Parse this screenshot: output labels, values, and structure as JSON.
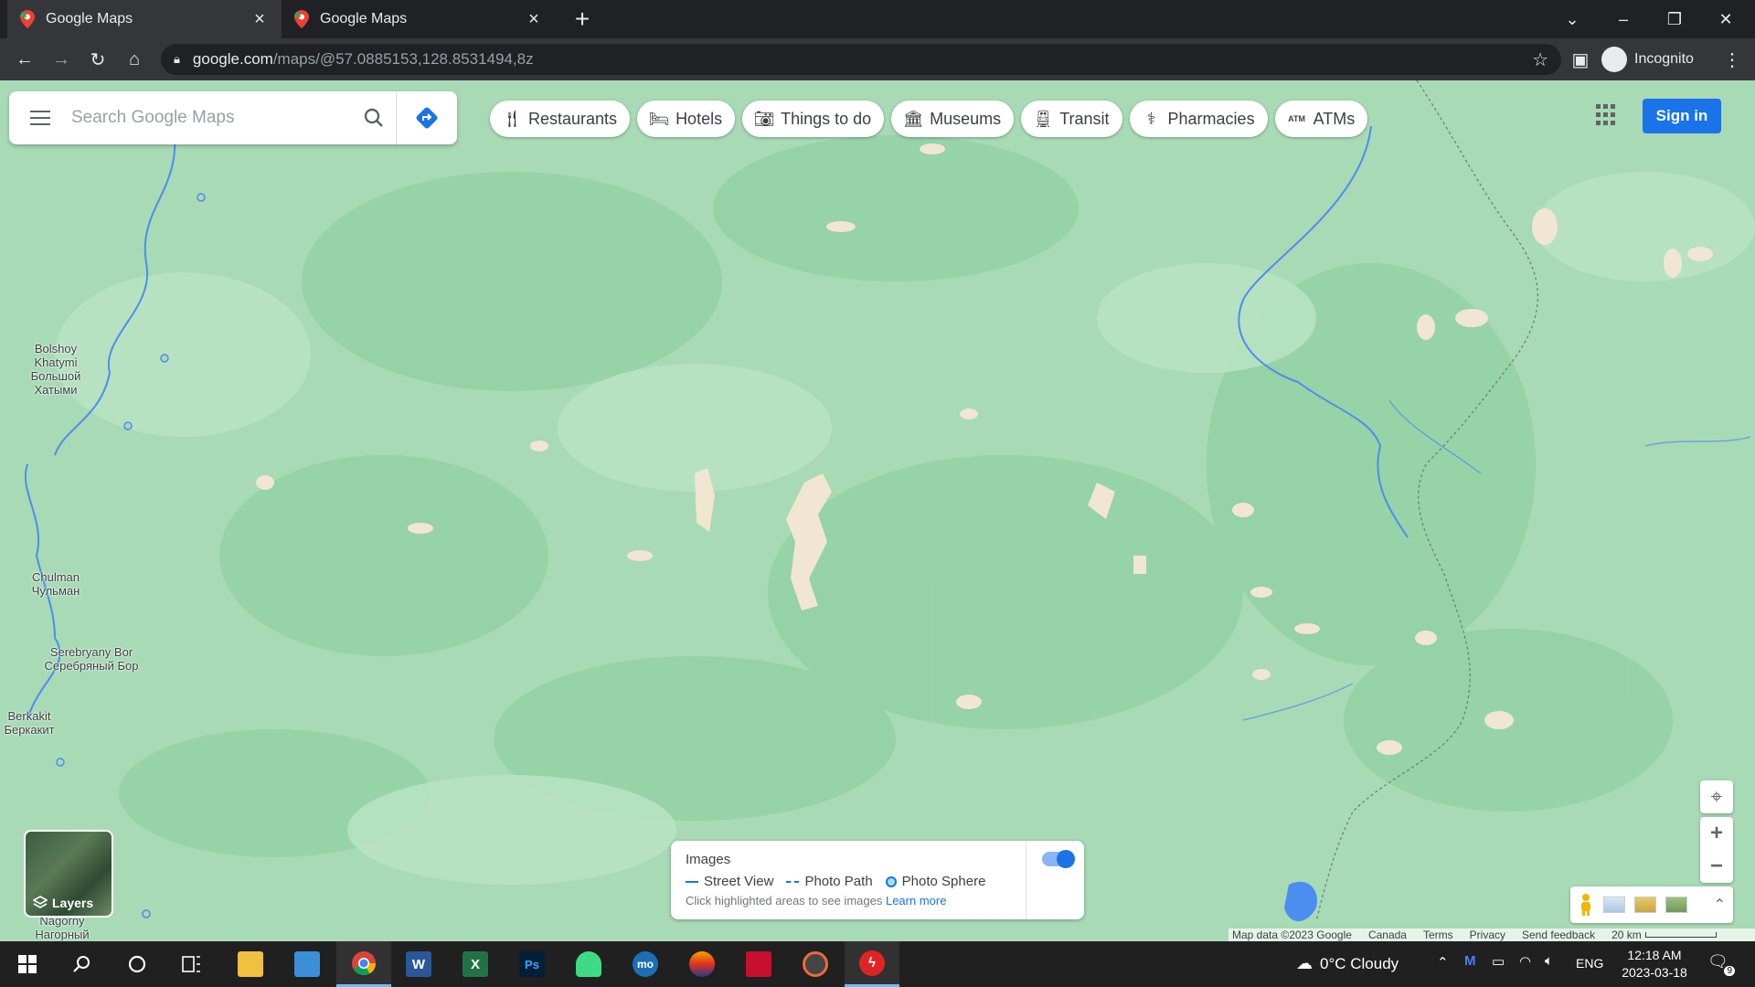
{
  "browser": {
    "tabs": [
      {
        "title": "Google Maps",
        "active": true
      },
      {
        "title": "Google Maps",
        "active": false
      }
    ],
    "new_tab_icon": "plus-icon",
    "url_host": "google.com",
    "url_path": "/maps/@57.0885153,128.8531494,8z",
    "profile_label": "Incognito"
  },
  "maps": {
    "search_placeholder": "Search Google Maps",
    "chips": [
      {
        "label": "Restaurants",
        "icon": "fork-knife-icon"
      },
      {
        "label": "Hotels",
        "icon": "bed-icon"
      },
      {
        "label": "Things to do",
        "icon": "camera-icon"
      },
      {
        "label": "Museums",
        "icon": "museum-icon"
      },
      {
        "label": "Transit",
        "icon": "train-icon"
      },
      {
        "label": "Pharmacies",
        "icon": "pharmacy-icon"
      },
      {
        "label": "ATMs",
        "icon": "atm-icon"
      }
    ],
    "sign_in_label": "Sign in",
    "labels": {
      "bolshoy_latin": "Bolshoy Khatymi",
      "bolshoy_cyr": "Большой Хатыми",
      "chulman_latin": "Chulman",
      "chulman_cyr": "Чульман",
      "serebryany_latin": "Serebryany Bor",
      "serebryany_cyr": "Серебряный Бор",
      "berkakit_latin": "Berkakit",
      "berkakit_cyr": "Беркакит",
      "nagorny_latin": "Nagorny",
      "nagorny_cyr": "Нагорный"
    },
    "layers_label": "Layers",
    "images_card": {
      "title": "Images",
      "street_view": "Street View",
      "photo_path": "Photo Path",
      "photo_sphere": "Photo Sphere",
      "hint": "Click highlighted areas to see images",
      "learn_more": "Learn more",
      "toggle_on": true
    },
    "footer": {
      "map_data": "Map data ©2023 Google",
      "region": "Canada",
      "terms": "Terms",
      "privacy": "Privacy",
      "feedback": "Send feedback",
      "scale": "20 km"
    },
    "colors": {
      "forest": "#a8dab5",
      "forest_dark": "#94d2a5",
      "river": "#4b8ef0",
      "accent": "#1a73e8"
    }
  },
  "taskbar": {
    "weather": "0°C  Cloudy",
    "language": "ENG",
    "time": "12:18 AM",
    "date": "2023-03-18",
    "notification_count": "9"
  }
}
